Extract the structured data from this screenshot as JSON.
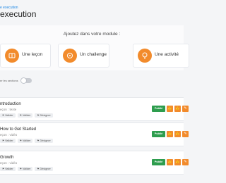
{
  "breadcrumb": "e execution",
  "page_title": "execution",
  "add_module": {
    "title": "Ajoutez dans votre module :",
    "options": [
      {
        "label": "Une leçon",
        "icon": "lesson-icon"
      },
      {
        "label": "Un challenge",
        "icon": "challenge-icon"
      },
      {
        "label": "Une activité",
        "icon": "activity-icon"
      }
    ]
  },
  "toggle_label": "er les sections",
  "sections": [
    {
      "title": "ntroduction",
      "subtitle": "eçon : texte"
    },
    {
      "title": "How to Get Started",
      "subtitle": "eçon : vidéo"
    },
    {
      "title": "Growth",
      "subtitle": "eçon : vidéo"
    }
  ],
  "section_buttons": [
    "Valider",
    "Valider",
    "Désigner"
  ],
  "status_label": "Publié",
  "colors": {
    "accent": "#f28b2c",
    "published": "#2e9d4e",
    "link": "#1e88e5"
  }
}
